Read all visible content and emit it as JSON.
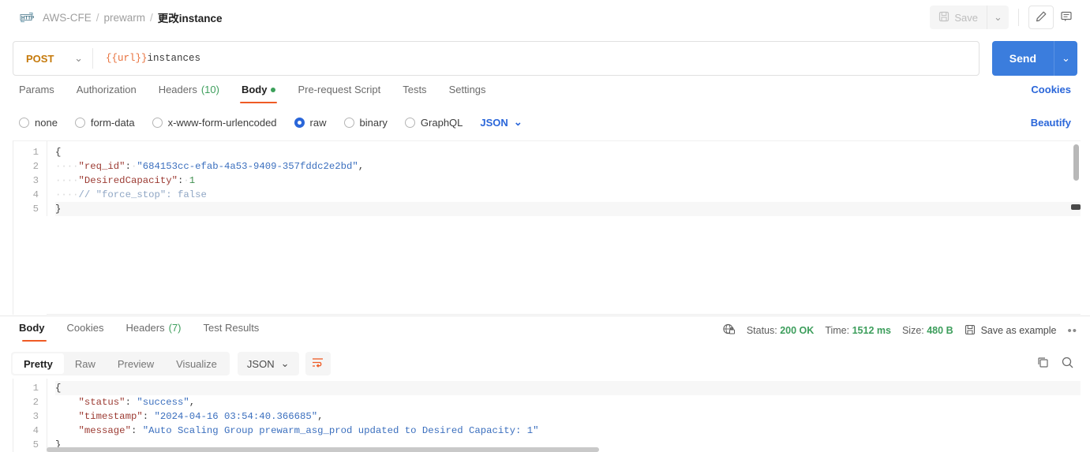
{
  "breadcrumb": {
    "icon": "http-icon",
    "collection": "AWS-CFE",
    "folder": "prewarm",
    "request": "更改instance",
    "separator": "/"
  },
  "topbar": {
    "save_label": "Save",
    "save_caret": "⌄",
    "edit_icon": "pencil-icon",
    "comment_icon": "comment-icon"
  },
  "url_bar": {
    "method": "POST",
    "method_caret": "⌄",
    "url_variable": "{{url}}",
    "url_path": "instances",
    "send_label": "Send",
    "send_caret": "⌄"
  },
  "request_tabs": {
    "items": [
      {
        "label": "Params",
        "badge": ""
      },
      {
        "label": "Authorization",
        "badge": ""
      },
      {
        "label": "Headers",
        "badge": "(10)"
      },
      {
        "label": "Body",
        "badge": ""
      },
      {
        "label": "Pre-request Script",
        "badge": ""
      },
      {
        "label": "Tests",
        "badge": ""
      },
      {
        "label": "Settings",
        "badge": ""
      }
    ],
    "active": "Body",
    "cookies_link": "Cookies"
  },
  "body_options": {
    "radios": [
      {
        "label": "none",
        "selected": false
      },
      {
        "label": "form-data",
        "selected": false
      },
      {
        "label": "x-www-form-urlencoded",
        "selected": false
      },
      {
        "label": "raw",
        "selected": true
      },
      {
        "label": "binary",
        "selected": false
      },
      {
        "label": "GraphQL",
        "selected": false
      }
    ],
    "format": "JSON",
    "format_caret": "⌄",
    "beautify_link": "Beautify"
  },
  "request_body": {
    "line_numbers": [
      "1",
      "2",
      "3",
      "4",
      "5"
    ],
    "lines": [
      {
        "n": "1",
        "text": "{"
      },
      {
        "n": "2",
        "text": "    \"req_id\": \"684153cc-efab-4a53-9409-357fddc2e2bd\","
      },
      {
        "n": "3",
        "text": "    \"DesiredCapacity\": 1"
      },
      {
        "n": "4",
        "text": "    // \"force_stop\": false"
      },
      {
        "n": "5",
        "text": "}"
      }
    ],
    "tokens": {
      "key_req_id": "\"req_id\"",
      "val_req_id": "\"684153cc-efab-4a53-9409-357fddc2e2bd\"",
      "key_desired_capacity": "\"DesiredCapacity\"",
      "val_desired_capacity": "1",
      "comment": "// \"force_stop\": false",
      "open_brace": "{",
      "close_brace": "}"
    }
  },
  "response_tabs": {
    "items": [
      {
        "label": "Body",
        "badge": ""
      },
      {
        "label": "Cookies",
        "badge": ""
      },
      {
        "label": "Headers",
        "badge": "(7)"
      },
      {
        "label": "Test Results",
        "badge": ""
      }
    ],
    "active": "Body"
  },
  "response_meta": {
    "secure_icon": "globe-lock-icon",
    "status_label": "Status:",
    "status_value": "200 OK",
    "time_label": "Time:",
    "time_value": "1512 ms",
    "size_label": "Size:",
    "size_value": "480 B",
    "save_example": "Save as example",
    "more_icon": "more-options-icon"
  },
  "response_toolbar": {
    "views": [
      "Pretty",
      "Raw",
      "Preview",
      "Visualize"
    ],
    "active_view": "Pretty",
    "format": "JSON",
    "format_caret": "⌄",
    "wrap_icon": "word-wrap-icon",
    "copy_icon": "copy-icon",
    "search_icon": "search-icon"
  },
  "response_body": {
    "line_numbers": [
      "1",
      "2",
      "3",
      "4",
      "5"
    ],
    "tokens": {
      "open_brace": "{",
      "key_status": "\"status\"",
      "val_status": "\"success\"",
      "key_timestamp": "\"timestamp\"",
      "val_timestamp": "\"2024-04-16 03:54:40.366685\"",
      "key_message": "\"message\"",
      "val_message": "\"Auto Scaling Group prewarm_asg_prod updated to Desired Capacity: 1\"",
      "close_brace": "}"
    }
  },
  "colors": {
    "accent_orange": "#ef5b25",
    "send_blue": "#3b7ddd",
    "link_blue": "#2a66d9",
    "status_green": "#3d9e5c",
    "method_amber": "#c5790a"
  }
}
